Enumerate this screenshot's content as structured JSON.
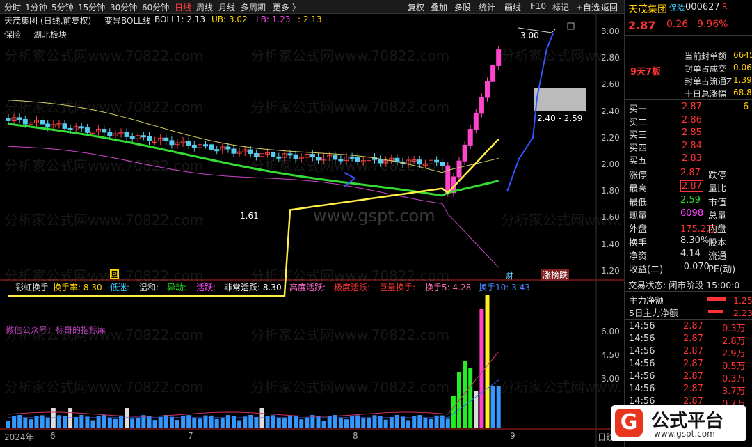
{
  "toolbar": {
    "periods": [
      "分时",
      "1分钟",
      "5分钟",
      "15分钟",
      "30分钟",
      "60分钟",
      "日线",
      "周线",
      "月线",
      "多周期",
      "更多 〉"
    ],
    "active": "日线",
    "right_buttons": [
      "复权",
      "叠加",
      "多股",
      "统计",
      "画线",
      "F10",
      "标记",
      "+自选",
      "返回"
    ]
  },
  "chart_header": {
    "stock": "天茂集团",
    "period": "(日线,前复权)",
    "indicator": "变异BOLL线",
    "boll1": "BOLL1: 2.13",
    "ub": "UB: 3.02",
    "lb": "LB: 1.23",
    "extra": ": 2.13",
    "tags": [
      "保险",
      "湖北板块"
    ]
  },
  "price_axis": [
    "3.00",
    "2.80",
    "2.60",
    "2.40",
    "2.20",
    "2.00",
    "1.80",
    "1.60",
    "1.40",
    "1.20"
  ],
  "vol_axis": [
    "6.00",
    "4.50",
    "3.00"
  ],
  "annotations": {
    "high": "3.00",
    "low": "1.61",
    "range": "2.40 - 2.59",
    "limit_board": "9天7板",
    "badge_cai": "财",
    "badge_zhangdie": "涨榜跌",
    "box_icon": "回"
  },
  "watermarks": {
    "site": "分析家公式网www.70822.com",
    "gspt": "www.gspt.com",
    "wechat": "微信公众号：标哥的指标库"
  },
  "vol_header": {
    "indicator": "彩虹换手",
    "rate": "换手率: 8.30",
    "low": "低迷: -",
    "mild": "温和: -",
    "move": "异动: -",
    "active": "活跃: -",
    "very_active": "非常活跃: 8.30",
    "high": "高度活跃: -",
    "extreme": "极度活跃: -",
    "huge": "巨量换手: -",
    "hs5": "换手5: 4.28",
    "hs10": "换手10: 3.43"
  },
  "x_axis": {
    "year": "2024年",
    "m6": "6",
    "m7": "7",
    "m8": "8",
    "m9": "9",
    "right": "日线"
  },
  "quote": {
    "name": "天茂集团",
    "tag": "保险",
    "code": "000627",
    "r": "R",
    "price": "2.87",
    "change": "0.26",
    "pct": "9.96%",
    "seal": [
      [
        "当前封单额",
        "6645"
      ],
      [
        "封单占成交",
        "0.06"
      ],
      [
        "封单占流通Z",
        "1.39"
      ],
      [
        "十日总涨幅",
        "68.8"
      ]
    ],
    "bids": [
      [
        "买一",
        "2.87",
        "6"
      ],
      [
        "买二",
        "2.86",
        ""
      ],
      [
        "买三",
        "2.85",
        ""
      ],
      [
        "买四",
        "2.84",
        ""
      ],
      [
        "买五",
        "2.83",
        ""
      ]
    ],
    "stats": [
      [
        "涨停",
        "2.87",
        "跌停",
        ""
      ],
      [
        "最高",
        "2.87",
        "量比",
        ""
      ],
      [
        "最低",
        "2.59",
        "市值",
        ""
      ],
      [
        "现量",
        "6098",
        "总量",
        ""
      ],
      [
        "外盘",
        "175.2万",
        "内盘",
        ""
      ],
      [
        "换手",
        "8.30%",
        "股本",
        ""
      ],
      [
        "净资",
        "4.14",
        "流通",
        ""
      ],
      [
        "收益(二)",
        "-0.070",
        "PE(动)",
        ""
      ]
    ],
    "trade_state": "交易状态: 闭市阶段 15:00:0",
    "flows": [
      [
        "主力净额",
        "1.25亿"
      ],
      [
        "5日主力净额",
        "2.23亿"
      ]
    ],
    "ticks": [
      [
        "14:56",
        "2.87",
        "0.3万"
      ],
      [
        "14:56",
        "2.87",
        "2.8万"
      ],
      [
        "14:56",
        "2.87",
        "2.9万"
      ],
      [
        "14:56",
        "2.87",
        "0.5万"
      ],
      [
        "14:56",
        "2.87",
        "0.3万"
      ],
      [
        "14:56",
        "2.87",
        "3.7万"
      ],
      [
        "14:56",
        "2.87",
        "0.7万"
      ]
    ]
  },
  "logo": {
    "brand": "公式平台",
    "url": "www.gspt.com",
    "glyph": "G"
  },
  "colors": {
    "up": "#ff3333",
    "down": "#22dd22",
    "accent": "#ffd700"
  }
}
